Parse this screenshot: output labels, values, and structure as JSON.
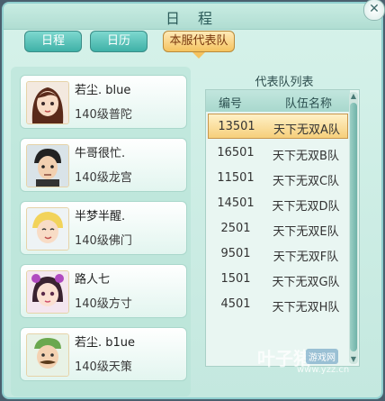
{
  "window": {
    "title": "日 程",
    "close_icon": "close-icon"
  },
  "tabs": [
    {
      "label": "日程"
    },
    {
      "label": "日历"
    },
    {
      "label": "本服代表队",
      "active": true
    }
  ],
  "members": [
    {
      "name": "若尘. blue",
      "level": "140级普陀"
    },
    {
      "name": "牛哥很忙.",
      "level": "140级龙宫"
    },
    {
      "name": "半梦半醒.",
      "level": "140级佛门"
    },
    {
      "name": "路人七",
      "level": "140级方寸"
    },
    {
      "name": "若尘. b1ue",
      "level": "140级天策"
    }
  ],
  "team_list": {
    "title": "代表队列表",
    "headers": {
      "code": "编号",
      "name": "队伍名称"
    },
    "rows": [
      {
        "code": "13501",
        "name": "天下无双A队",
        "selected": true
      },
      {
        "code": "16501",
        "name": "天下无双B队"
      },
      {
        "code": "11501",
        "name": "天下无双C队"
      },
      {
        "code": "14501",
        "name": "天下无双D队"
      },
      {
        "code": "2501",
        "name": "天下无双E队"
      },
      {
        "code": "9501",
        "name": "天下无双F队"
      },
      {
        "code": "1501",
        "name": "天下无双G队"
      },
      {
        "code": "4501",
        "name": "天下无双H队"
      }
    ]
  },
  "watermark": {
    "brand": "叶子猪",
    "badge": "游戏网",
    "url": "www.yzz.cn"
  },
  "colors": {
    "accent": "#3fb1a7",
    "active_tab": "#f5c35f",
    "selected_row": "#f6cf7b"
  }
}
